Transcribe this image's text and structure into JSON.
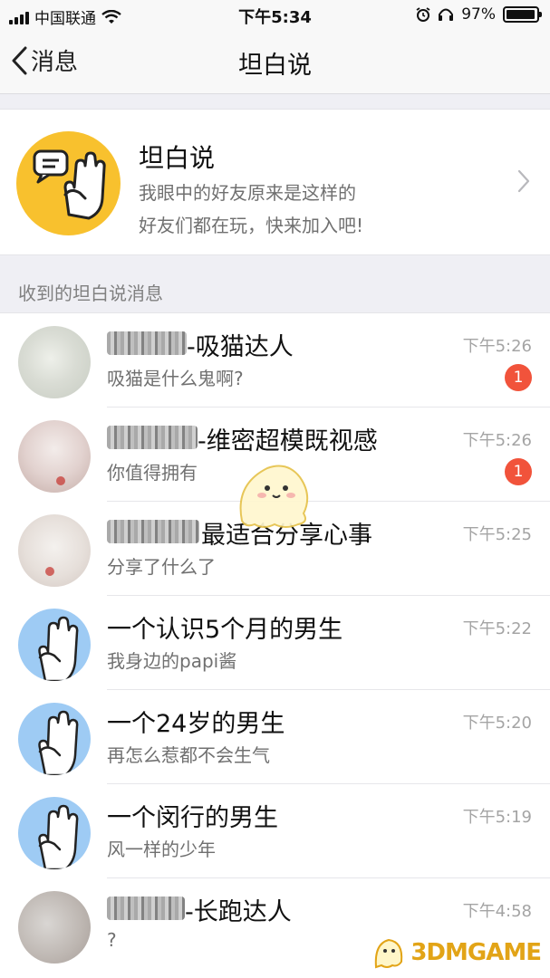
{
  "status_bar": {
    "carrier": "中国联通",
    "time": "下午5:34",
    "battery": "97%",
    "battery_level": 0.97
  },
  "nav": {
    "back_label": "消息",
    "title": "坦白说"
  },
  "promo": {
    "title": "坦白说",
    "line1": "我眼中的好友原来是这样的",
    "line2": "好友们都在玩，快来加入吧!"
  },
  "section_header": "收到的坦白说消息",
  "messages": [
    {
      "title": "-吸猫达人",
      "subtitle": "吸猫是什么鬼啊?",
      "time": "下午5:26",
      "badge": "1"
    },
    {
      "title": "-维密超模既视感",
      "subtitle": "你值得拥有",
      "time": "下午5:26",
      "badge": "1"
    },
    {
      "title": "最适合分享心事",
      "subtitle": "分享了什么了",
      "time": "下午5:25"
    },
    {
      "title": "一个认识5个月的男生",
      "subtitle": "我身边的papi酱",
      "time": "下午5:22"
    },
    {
      "title": "一个24岁的男生",
      "subtitle": "再怎么惹都不会生气",
      "time": "下午5:20"
    },
    {
      "title": "一个闵行的男生",
      "subtitle": "风一样的少年",
      "time": "下午5:19"
    },
    {
      "title": "-长跑达人",
      "subtitle": "?",
      "time": "下午4:58"
    }
  ],
  "watermark": "3DMGAME",
  "colors": {
    "accent": "#f8c12e",
    "badge": "#f1533b",
    "hand_avatar_bg": "#9ecbf4"
  }
}
